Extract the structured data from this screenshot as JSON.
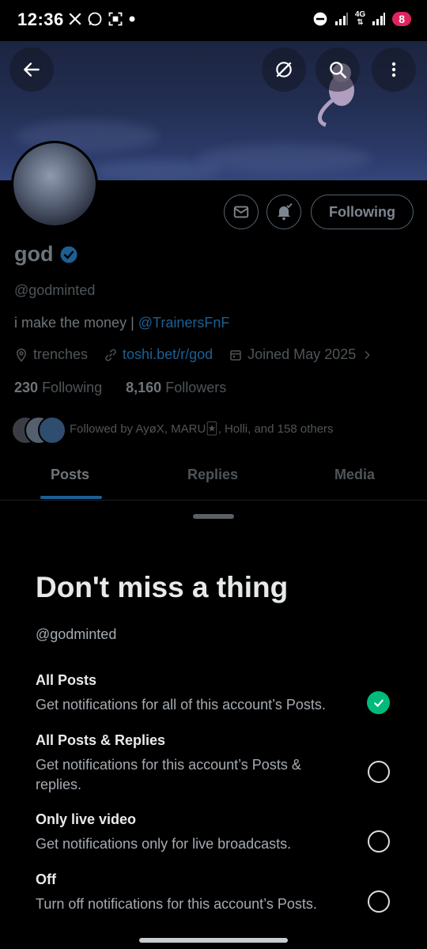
{
  "status_bar": {
    "time": "12:36",
    "network": "4G",
    "battery": "8",
    "left_icons": [
      "x-icon",
      "whatsapp-icon",
      "screenshot-icon",
      "dot-icon"
    ],
    "right_icons": [
      "do-not-disturb-icon",
      "signal-icon",
      "network-4g-icon",
      "signal-icon",
      "battery-icon"
    ]
  },
  "header": {
    "buttons": [
      "back-arrow-icon",
      "grok-icon",
      "search-icon",
      "more-icon"
    ]
  },
  "profile": {
    "name": "god",
    "verified": true,
    "handle": "@godminted",
    "bio_text": "i make the money | ",
    "bio_mention": "@TrainersFnF",
    "location": "trenches",
    "website": "toshi.bet/r/god",
    "joined": "Joined May 2025",
    "following_count": "230",
    "following_label": "Following",
    "followers_count": "8,160",
    "followers_label": "Followers",
    "followed_by": "Followed by AyøX, MARU🃏, Holli, and 158 others",
    "following_button": "Following"
  },
  "tabs": [
    {
      "label": "Posts",
      "active": true
    },
    {
      "label": "Replies",
      "active": false
    },
    {
      "label": "Media",
      "active": false
    }
  ],
  "sheet": {
    "title": "Don't miss a thing",
    "handle": "@godminted",
    "options": [
      {
        "title": "All Posts",
        "description": "Get notifications for all of this account’s Posts.",
        "selected": true
      },
      {
        "title": "All Posts & Replies",
        "description": "Get notifications for this account’s Posts & replies.",
        "selected": false
      },
      {
        "title": "Only live video",
        "description": "Get notifications only for live broadcasts.",
        "selected": false
      },
      {
        "title": "Off",
        "description": "Turn off notifications for this account’s Posts.",
        "selected": false
      }
    ]
  },
  "colors": {
    "accent": "#1d9bf0",
    "selected": "#00ba7c",
    "background": "#000000"
  }
}
